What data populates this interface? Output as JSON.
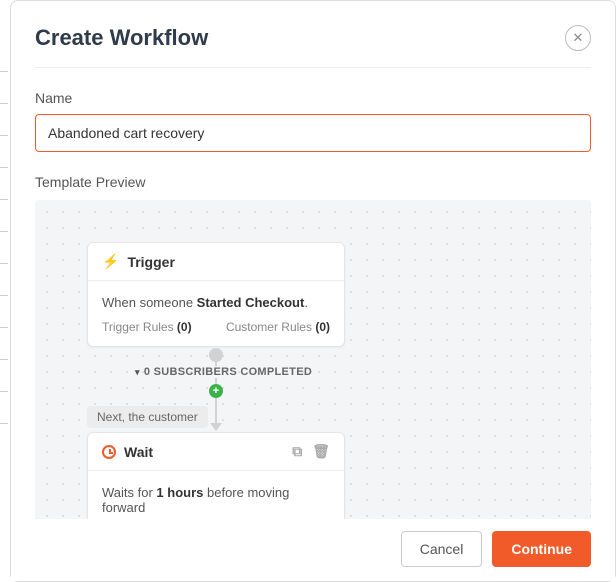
{
  "modal": {
    "title": "Create Workflow",
    "close_symbol": "✕"
  },
  "name_field": {
    "label": "Name",
    "value": "Abandoned cart recovery"
  },
  "preview": {
    "label": "Template Preview"
  },
  "trigger": {
    "title": "Trigger",
    "body_prefix": "When someone ",
    "body_bold": "Started Checkout",
    "body_suffix": ".",
    "rule1_label": "Trigger Rules ",
    "rule1_count": "(0)",
    "rule2_label": "Customer Rules ",
    "rule2_count": "(0)"
  },
  "connector": {
    "subscribers_prefix": "0",
    "subscribers_label": " SUBSCRIBERS COMPLETED",
    "plus": "+",
    "next_label": "Next, the customer"
  },
  "wait": {
    "title": "Wait",
    "body_prefix": "Waits for ",
    "body_bold": "1 hours",
    "body_suffix": " before moving forward"
  },
  "icons": {
    "bolt": "⚡",
    "copy": "⧉",
    "trash": "🗑",
    "caret": "▾"
  },
  "footer": {
    "cancel": "Cancel",
    "continue": "Continue"
  }
}
